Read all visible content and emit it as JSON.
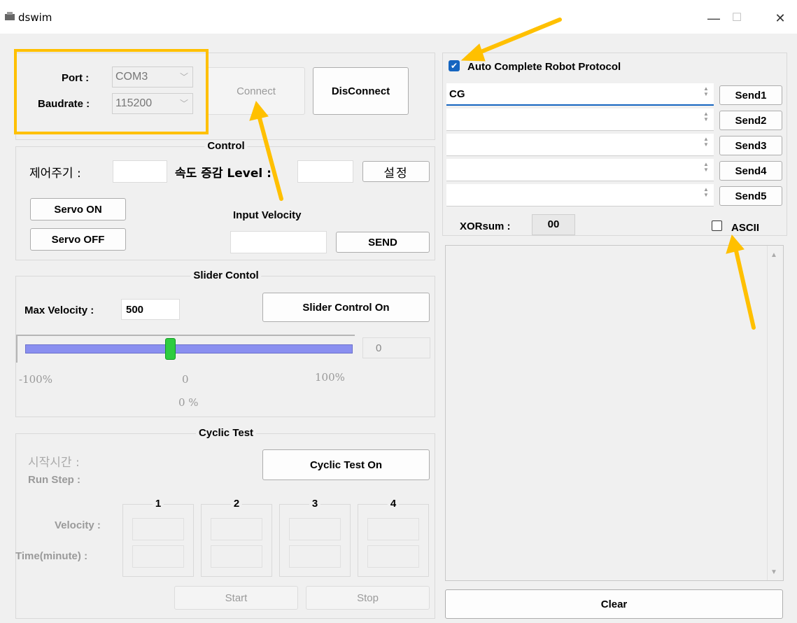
{
  "window": {
    "title": "dswim",
    "minimize": "—",
    "maximize": "☐",
    "close": "✕"
  },
  "connection": {
    "port_label": "Port :",
    "port_value": "COM3",
    "baud_label": "Baudrate :",
    "baud_value": "115200",
    "connect": "Connect",
    "disconnect": "DisConnect"
  },
  "control": {
    "title": "Control",
    "period_label": "제어주기 :",
    "speed_label": "속도 증감 Level :",
    "set_button": "설정",
    "servo_on": "Servo ON",
    "servo_off": "Servo OFF",
    "input_velocity_label": "Input Velocity",
    "send": "SEND"
  },
  "slider": {
    "title": "Slider Contol",
    "max_velocity_label": "Max Velocity :",
    "max_velocity_value": "500",
    "control_on": "Slider Control On",
    "value": "0",
    "min_label": "-100%",
    "zero_label": "0",
    "max_label": "100%",
    "percent": "0 %",
    "position_fraction": 0.5
  },
  "cyclic": {
    "title": "Cyclic Test",
    "start_time_label": "시작시간 :",
    "run_step_label": "Run Step :",
    "on_button": "Cyclic Test On",
    "steps": [
      "1",
      "2",
      "3",
      "4"
    ],
    "velocity_label": "Velocity :",
    "time_label": "Time(minute) :",
    "start": "Start",
    "stop": "Stop"
  },
  "protocol": {
    "auto_complete": "Auto Complete Robot Protocol",
    "auto_complete_checked": true,
    "inputs": [
      "CG",
      "",
      "",
      "",
      ""
    ],
    "send_buttons": [
      "Send1",
      "Send2",
      "Send3",
      "Send4",
      "Send5"
    ],
    "xor_label": "XORsum :",
    "xor_value": "00",
    "ascii_label": "ASCII",
    "ascii_checked": false,
    "clear": "Clear"
  },
  "colors": {
    "highlight_box": "#FFC000",
    "arrow": "#FFC000",
    "checkbox": "#1565c0",
    "slider_track": "#8a8ff0",
    "slider_thumb": "#2ecc40"
  }
}
